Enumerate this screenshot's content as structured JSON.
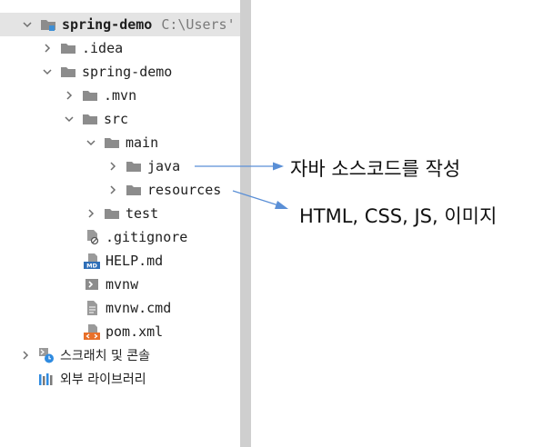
{
  "tree": {
    "root": {
      "label": "spring-demo",
      "path": "C:\\Users'"
    },
    "idea": ".idea",
    "module": "spring-demo",
    "mvn": ".mvn",
    "src": "src",
    "main": "main",
    "java": "java",
    "resources": "resources",
    "test": "test",
    "gitignore": ".gitignore",
    "help": "HELP.md",
    "mvnw": "mvnw",
    "mvnw_cmd": "mvnw.cmd",
    "pom": "pom.xml",
    "scratches": "스크래치 및 콘솔",
    "external_libs": "외부 라이브러리"
  },
  "annotations": {
    "java_note": "자바 소스코드를 작성",
    "resources_note": "HTML, CSS, JS, 이미지"
  },
  "colors": {
    "folder": "#8c8c8c",
    "selection": "#e4e4e4",
    "arrow_line": "#5a8fd6"
  }
}
